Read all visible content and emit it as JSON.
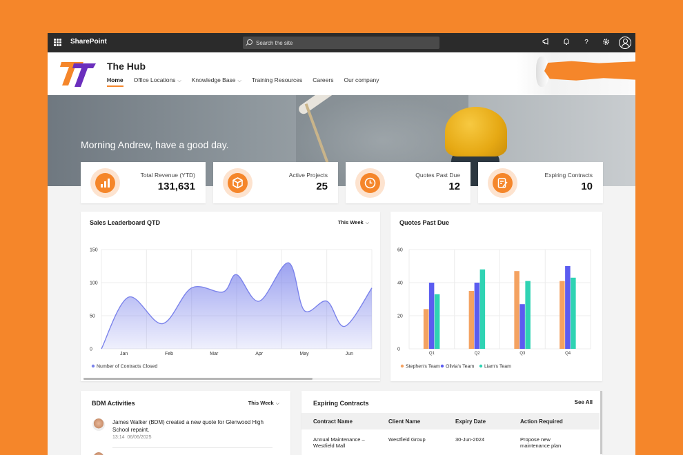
{
  "suitebar": {
    "app_name": "SharePoint",
    "search_placeholder": "Search the site"
  },
  "site": {
    "title": "The Hub",
    "nav": [
      {
        "label": "Home",
        "active": true,
        "dropdown": false
      },
      {
        "label": "Office Locations",
        "active": false,
        "dropdown": true
      },
      {
        "label": "Knowledge Base",
        "active": false,
        "dropdown": true
      },
      {
        "label": "Training Resources",
        "active": false,
        "dropdown": false
      },
      {
        "label": "Careers",
        "active": false,
        "dropdown": false
      },
      {
        "label": "Our company",
        "active": false,
        "dropdown": false
      }
    ]
  },
  "hero": {
    "greeting": "Morning Andrew, have a good day."
  },
  "kpis": [
    {
      "label": "Total Revenue (YTD)",
      "value": "131,631",
      "icon": "bar-chart-icon"
    },
    {
      "label": "Active Projects",
      "value": "25",
      "icon": "cube-icon"
    },
    {
      "label": "Quotes Past Due",
      "value": "12",
      "icon": "clock-icon"
    },
    {
      "label": "Expiring Contracts",
      "value": "10",
      "icon": "edit-document-icon"
    }
  ],
  "sales_panel": {
    "title": "Sales Leaderboard QTD",
    "filter": "This Week"
  },
  "quotes_panel": {
    "title": "Quotes Past Due"
  },
  "chart_data": [
    {
      "type": "area",
      "title": "Sales Leaderboard QTD",
      "x_ticks": [
        "Jan",
        "Feb",
        "Mar",
        "Apr",
        "May",
        "Jun"
      ],
      "y_ticks": [
        "0",
        "50",
        "100",
        "150"
      ],
      "ylim": [
        0,
        150
      ],
      "series": [
        {
          "name": "Number of Contracts Closed",
          "color": "#7b83eb",
          "x": [
            0.0,
            0.6,
            1.35,
            2.0,
            2.7,
            3.0,
            3.5,
            4.15,
            4.5,
            5.0,
            5.4,
            6.0
          ],
          "values": [
            0,
            78,
            38,
            92,
            86,
            112,
            72,
            130,
            58,
            72,
            34,
            92
          ]
        }
      ],
      "grid": true,
      "legend": "bottom-left"
    },
    {
      "type": "bar",
      "title": "Quotes Past Due",
      "categories": [
        "Q1",
        "Q2",
        "Q3",
        "Q4"
      ],
      "y_ticks": [
        "0",
        "20",
        "40",
        "60"
      ],
      "ylim": [
        0,
        60
      ],
      "series": [
        {
          "name": "Stephen's Team",
          "color": "#f4a261",
          "values": [
            24,
            35,
            47,
            41
          ]
        },
        {
          "name": "Olivia's Team",
          "color": "#5b5cf0",
          "values": [
            40,
            40,
            27,
            50
          ]
        },
        {
          "name": "Liam's Team",
          "color": "#2fd3b3",
          "values": [
            33,
            48,
            41,
            43
          ]
        }
      ],
      "grid": true,
      "legend": "bottom-left"
    }
  ],
  "bdm": {
    "title": "BDM Activities",
    "filter": "This Week",
    "activities": [
      {
        "text": "James Walker (BDM) created a new quote for Glenwood High School repaint.",
        "time": "13:14",
        "date": "06/06/2025"
      }
    ]
  },
  "contracts": {
    "title": "Expiring Contracts",
    "see_all": "See All",
    "columns": [
      "Contract Name",
      "Client Name",
      "Expiry Date",
      "Action Required"
    ],
    "rows": [
      [
        "Annual Maintenance – Westfield Mall",
        "Westfield Group",
        "30-Jun-2024",
        "Propose new maintenance plan"
      ]
    ]
  }
}
